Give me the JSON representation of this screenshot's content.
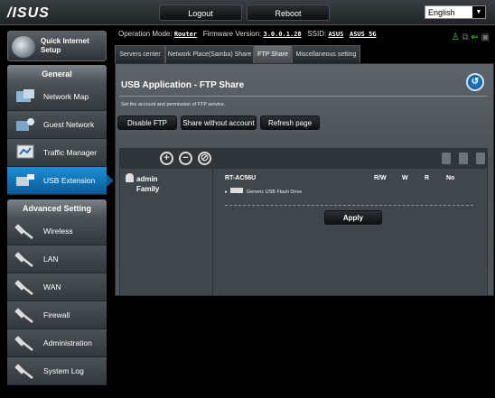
{
  "header": {
    "logo": "/ISUS",
    "logout_label": "Logout",
    "reboot_label": "Reboot",
    "language": "English"
  },
  "sidebar": {
    "quick_setup": "Quick Internet Setup",
    "general_title": "General",
    "general_items": [
      {
        "label": "Network Map",
        "icon": "network-map-icon"
      },
      {
        "label": "Guest Network",
        "icon": "guest-network-icon"
      },
      {
        "label": "Traffic Manager",
        "icon": "traffic-manager-icon"
      },
      {
        "label": "USB Extension",
        "icon": "usb-extension-icon"
      }
    ],
    "advanced_title": "Advanced Setting",
    "advanced_items": [
      {
        "label": "Wireless",
        "icon": "wrench-icon"
      },
      {
        "label": "LAN",
        "icon": "wrench-icon"
      },
      {
        "label": "WAN",
        "icon": "wrench-icon"
      },
      {
        "label": "Firewall",
        "icon": "wrench-icon"
      },
      {
        "label": "Administration",
        "icon": "wrench-icon"
      },
      {
        "label": "System Log",
        "icon": "wrench-icon"
      }
    ]
  },
  "info": {
    "mode_label": "Operation Mode:",
    "mode_value": "Router",
    "fw_label": "Firmware Version:",
    "fw_value": "3.0.0.1.28",
    "ssid_label": "SSID:",
    "ssid_1": "ASUS",
    "ssid_2": "ASUS_5G"
  },
  "tabs": [
    "Servers center",
    "Network Place(Samba) Share",
    "FTP Share",
    "Miscellaneous setting"
  ],
  "page": {
    "title": "USB Application - FTP Share",
    "description": "Set the account and permission of FTP service.",
    "disable_ftp": "Disable FTP",
    "share_without_account": "Share without account",
    "refresh": "Refresh page"
  },
  "users": [
    "admin",
    "Family"
  ],
  "permissions": {
    "device": "RT-AC56U",
    "headers": [
      "R/W",
      "W",
      "R",
      "No"
    ],
    "disk": "Generic USB Flash Drive",
    "apply": "Apply"
  },
  "colors": {
    "accent": "#1c8fd6",
    "usb_green": "#3ed13e"
  }
}
